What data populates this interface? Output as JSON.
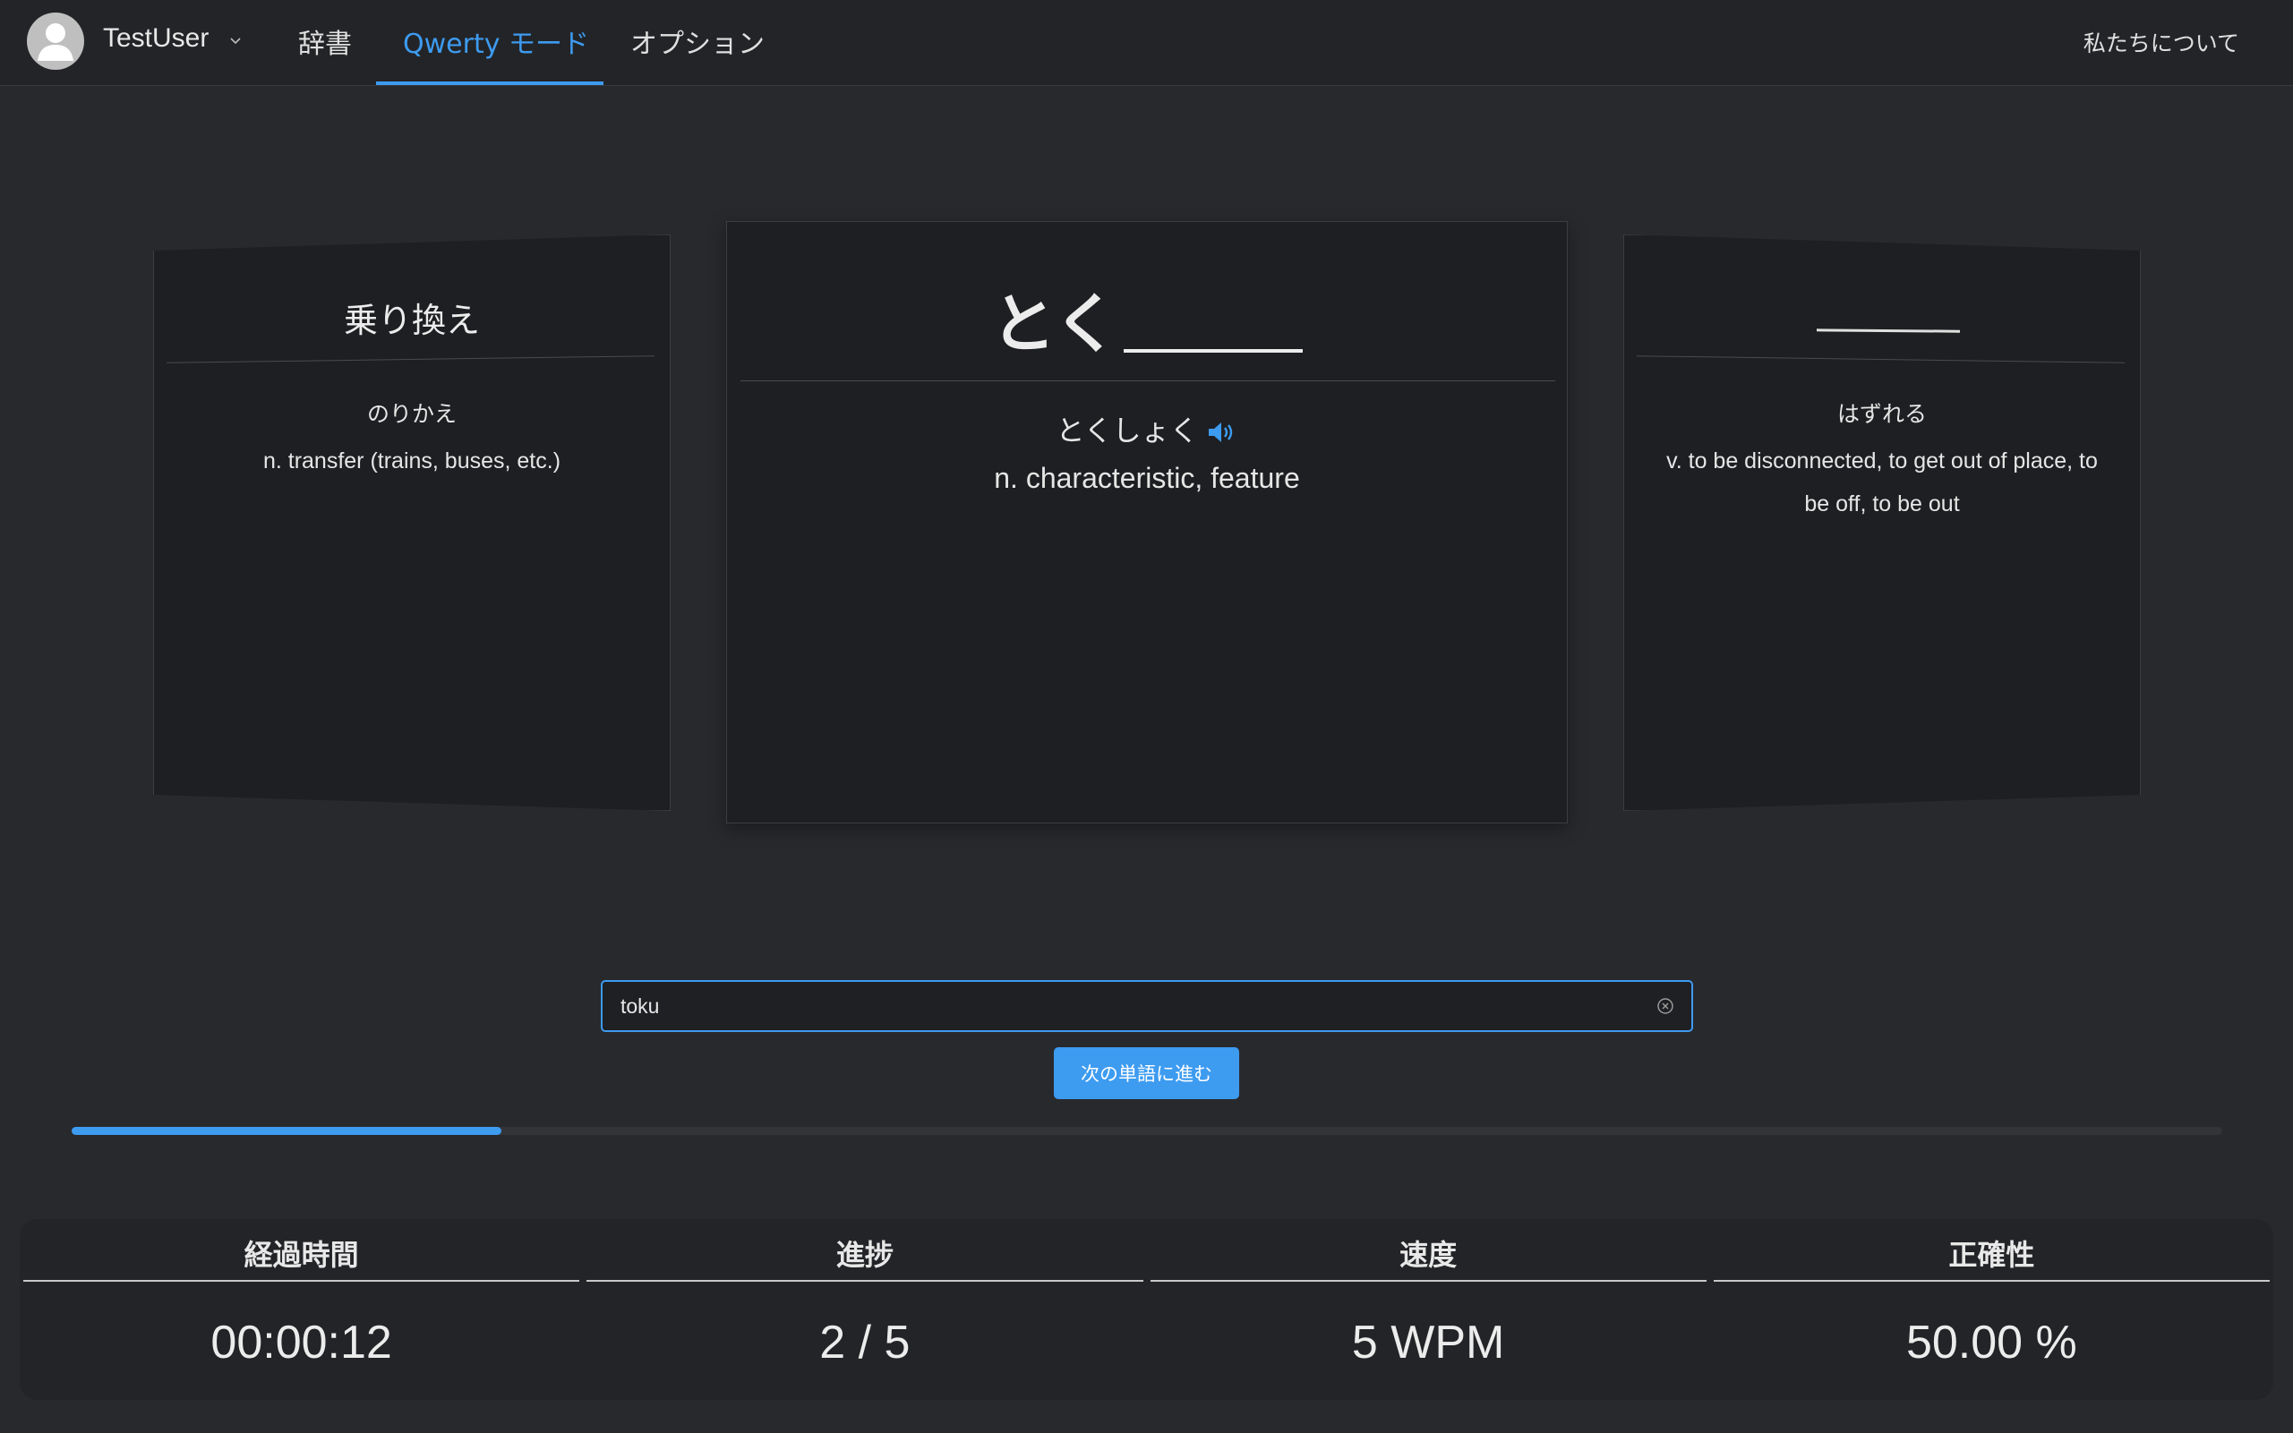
{
  "header": {
    "username": "TestUser",
    "nav": {
      "dictionary": "辞書",
      "qwerty_mode": "Qwerty モード",
      "options": "オプション",
      "about": "私たちについて"
    },
    "active_tab": "qwerty_mode",
    "icons": {
      "avatar": "user-avatar-icon",
      "dropdown": "chevron-down-icon"
    }
  },
  "cards": {
    "previous": {
      "word": "乗り換え",
      "reading": "のりかえ",
      "meaning": "n. transfer (trains, buses, etc.)"
    },
    "current": {
      "word_typed": "とく",
      "reading": "とくしょく",
      "meaning": "n. characteristic, feature",
      "audio_icon": "speaker-icon"
    },
    "next": {
      "word": "",
      "reading": "はずれる",
      "meaning": "v. to be disconnected, to get out of place, to be off, to be out"
    }
  },
  "input": {
    "value": "toku",
    "placeholder": "",
    "clear_icon": "clear-circle-icon"
  },
  "next_button": "次の単語に進む",
  "progress": {
    "fraction": 0.2
  },
  "stats": {
    "elapsed_label": "経過時間",
    "elapsed_value": "00:00:12",
    "progress_label": "進捗",
    "progress_value": "2 / 5",
    "speed_label": "速度",
    "speed_value": "5 WPM",
    "accuracy_label": "正確性",
    "accuracy_value": "50.00 %"
  },
  "colors": {
    "accent": "#3d9bf0",
    "background": "#28292d",
    "card": "#1e1f22"
  }
}
